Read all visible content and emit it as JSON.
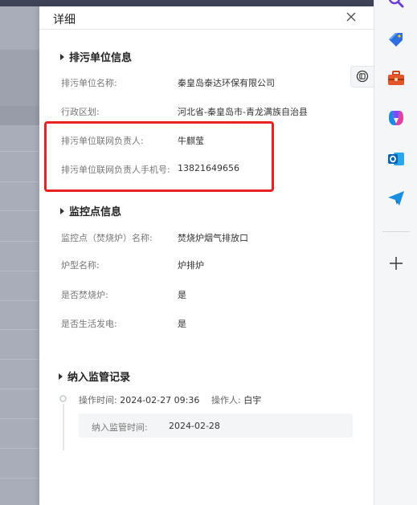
{
  "drawer": {
    "title": "详细",
    "sections": {
      "unit": {
        "title": "排污单位信息",
        "fields": [
          {
            "label": "排污单位名称:",
            "value": "秦皇岛泰达环保有限公司"
          },
          {
            "label": "行政区划:",
            "value": "河北省-秦皇岛市-青龙满族自治县"
          },
          {
            "label": "排污单位联网负责人:",
            "value": "牛麒莹"
          },
          {
            "label": "排污单位联网负责人手机号:",
            "value": "13821649656"
          }
        ]
      },
      "monitor": {
        "title": "监控点信息",
        "fields": [
          {
            "label": "监控点（焚烧炉）名称:",
            "value": "焚烧炉烟气排放口"
          },
          {
            "label": "炉型名称:",
            "value": "炉排炉"
          },
          {
            "label": "是否焚烧炉:",
            "value": "是"
          },
          {
            "label": "是否生活发电:",
            "value": "是"
          }
        ]
      },
      "supervision": {
        "title": "纳入监管记录",
        "record": {
          "op_time_label": "操作时间:",
          "op_time": "2024-02-27 09:36",
          "operator_label": "操作人:",
          "operator": "白宇",
          "supervise_time_label": "纳入监管时间:",
          "supervise_time": "2024-02-28"
        }
      }
    }
  },
  "colors": {
    "highlight": "#e82121",
    "overlay": "#a9adb9"
  },
  "sidebar_icons": [
    "search-icon",
    "tag-icon",
    "toolbox-icon",
    "copilot-icon",
    "outlook-icon",
    "send-icon",
    "add-icon"
  ]
}
